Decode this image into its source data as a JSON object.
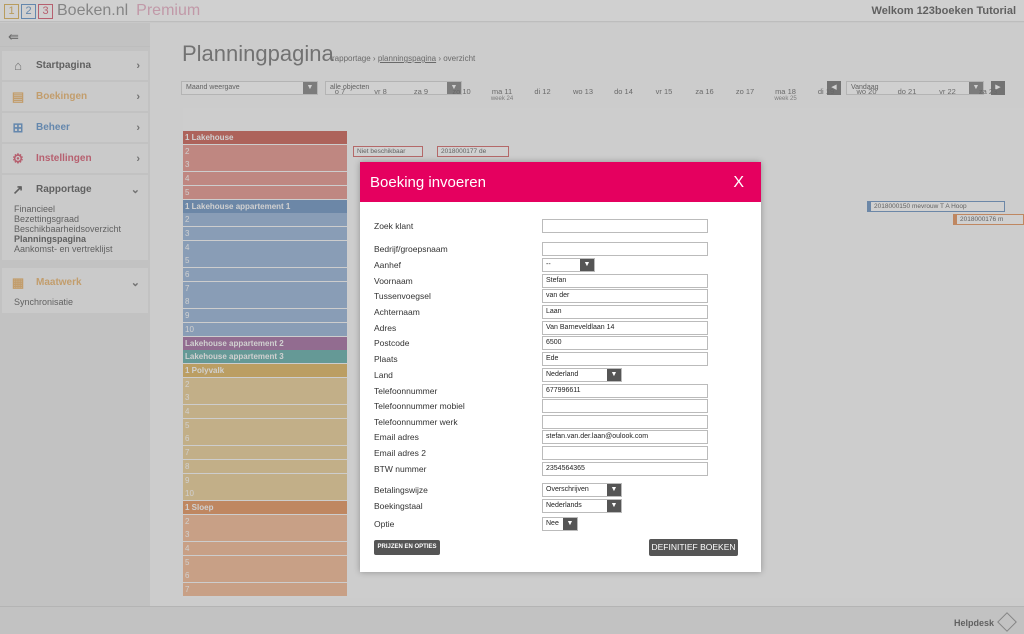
{
  "app": {
    "logo_digits": [
      "1",
      "2",
      "3"
    ],
    "logo_text": "Boeken.nl",
    "plan": "Premium",
    "welcome": "Welkom 123boeken Tutorial"
  },
  "sidebar": {
    "items": [
      {
        "label": "Startpagina",
        "color": "#555555"
      },
      {
        "label": "Boekingen",
        "color": "#e5a24a"
      },
      {
        "label": "Beheer",
        "color": "#3b7bbf"
      },
      {
        "label": "Instellingen",
        "color": "#d0334f"
      }
    ],
    "rapportage": {
      "label": "Rapportage",
      "sub": [
        "Financieel",
        "Bezettingsgraad",
        "Beschikbaarheidsoverzicht",
        "Planningspagina",
        "Aankomst- en vertreklijst"
      ]
    },
    "maatwerk": {
      "label": "Maatwerk",
      "sub": [
        "Synchronisatie"
      ]
    }
  },
  "page": {
    "title": "Planningpagina",
    "crumb1": "rapportage ›",
    "crumb2": "planningspagina",
    "crumb3": "› overzicht"
  },
  "toolbar": {
    "view": "Maand weergave",
    "objects": "alle objecten",
    "today": "Vandaag",
    "prev": "◀",
    "next": "▶"
  },
  "days": [
    {
      "d": "o 7"
    },
    {
      "d": "vr 8"
    },
    {
      "d": "za 9"
    },
    {
      "d": "zo 10"
    },
    {
      "d": "ma 11",
      "w": "week 24"
    },
    {
      "d": "di 12"
    },
    {
      "d": "wo 13"
    },
    {
      "d": "do 14"
    },
    {
      "d": "vr 15"
    },
    {
      "d": "za 16"
    },
    {
      "d": "zo 17"
    },
    {
      "d": "ma 18",
      "w": "week 25"
    },
    {
      "d": "di 19"
    },
    {
      "d": "wo 20"
    },
    {
      "d": "do 21"
    },
    {
      "d": "vr 22"
    },
    {
      "d": "za 23"
    }
  ],
  "rows": [
    {
      "label": "1 Lakehouse",
      "color": "#c0392b",
      "h": true
    },
    {
      "label": "2",
      "color": "#e07b6f"
    },
    {
      "label": "3",
      "color": "#e07b6f"
    },
    {
      "label": "4",
      "color": "#e07b6f"
    },
    {
      "label": "5",
      "color": "#e07b6f"
    },
    {
      "label": "1 Lakehouse appartement 1",
      "color": "#4a7ab5",
      "h": true
    },
    {
      "label": "2",
      "color": "#7ea3cf"
    },
    {
      "label": "3",
      "color": "#7ea3cf"
    },
    {
      "label": "4",
      "color": "#7ea3cf"
    },
    {
      "label": "5",
      "color": "#7ea3cf"
    },
    {
      "label": "6",
      "color": "#7ea3cf"
    },
    {
      "label": "7",
      "color": "#7ea3cf"
    },
    {
      "label": "8",
      "color": "#7ea3cf"
    },
    {
      "label": "9",
      "color": "#7ea3cf"
    },
    {
      "label": "10",
      "color": "#7ea3cf"
    },
    {
      "label": "Lakehouse appartement 2",
      "color": "#8e4a8a",
      "h": true
    },
    {
      "label": "Lakehouse appartement 3",
      "color": "#3d9b96",
      "h": true
    },
    {
      "label": "1 Polyvalk",
      "color": "#d9a53a",
      "h": true
    },
    {
      "label": "2",
      "color": "#e6c37d"
    },
    {
      "label": "3",
      "color": "#e6c37d"
    },
    {
      "label": "4",
      "color": "#e6c37d"
    },
    {
      "label": "5",
      "color": "#e6c37d"
    },
    {
      "label": "6",
      "color": "#e6c37d"
    },
    {
      "label": "7",
      "color": "#e6c37d"
    },
    {
      "label": "8",
      "color": "#e6c37d"
    },
    {
      "label": "9",
      "color": "#e6c37d"
    },
    {
      "label": "10",
      "color": "#e6c37d"
    },
    {
      "label": "1 Sloep",
      "color": "#e07a36",
      "h": true
    },
    {
      "label": "2",
      "color": "#f0a878"
    },
    {
      "label": "3",
      "color": "#f0a878"
    },
    {
      "label": "4",
      "color": "#f0a878"
    },
    {
      "label": "5",
      "color": "#f0a878"
    },
    {
      "label": "6",
      "color": "#f0a878"
    },
    {
      "label": "7",
      "color": "#f0a878"
    }
  ],
  "events": {
    "e1": "Niet beschikbaar",
    "e2": "2018000177 de",
    "e3": "2018000150 mevrouw T A Hoop",
    "e4": "2018000176 m"
  },
  "modal": {
    "title": "Boeking invoeren",
    "close": "X",
    "fields": [
      {
        "label": "Zoek klant",
        "value": ""
      },
      {
        "label": "Bedrijf/groepsnaam",
        "value": ""
      },
      {
        "label": "Aanhef",
        "value": "--",
        "select": true
      },
      {
        "label": "Voornaam",
        "value": "Stefan"
      },
      {
        "label": "Tussenvoegsel",
        "value": "van der"
      },
      {
        "label": "Achternaam",
        "value": "Laan"
      },
      {
        "label": "Adres",
        "value": "Van Barneveldlaan 14"
      },
      {
        "label": "Postcode",
        "value": "6500"
      },
      {
        "label": "Plaats",
        "value": "Ede"
      },
      {
        "label": "Land",
        "value": "Nederland",
        "select": true
      },
      {
        "label": "Telefoonnummer",
        "value": "677996611"
      },
      {
        "label": "Telefoonnummer mobiel",
        "value": ""
      },
      {
        "label": "Telefoonnummer werk",
        "value": ""
      },
      {
        "label": "Email adres",
        "value": "stefan.van.der.laan@oulook.com"
      },
      {
        "label": "Email adres 2",
        "value": ""
      },
      {
        "label": "BTW nummer",
        "value": "2354564365"
      },
      {
        "label": "Betalingswijze",
        "value": "Overschrijven",
        "select": true
      },
      {
        "label": "Boekingstaal",
        "value": "Nederlands",
        "select": true
      },
      {
        "label": "Optie",
        "value": "Nee",
        "select": true
      }
    ],
    "btn_prices": "PRIJZEN EN OPTIES",
    "btn_book": "DEFINITIEF BOEKEN"
  },
  "footer": {
    "helpdesk": "Helpdesk"
  }
}
